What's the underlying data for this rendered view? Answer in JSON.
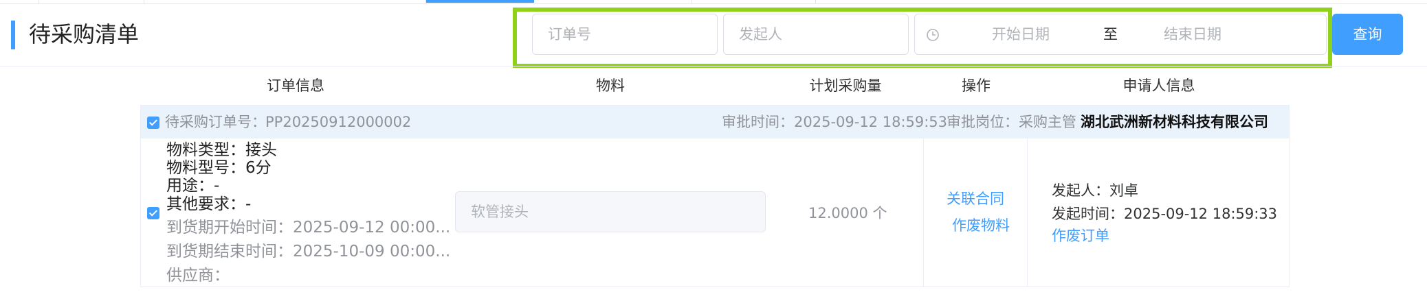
{
  "header": {
    "title": "待采购清单",
    "search": {
      "order_no_placeholder": "订单号",
      "initiator_placeholder": "发起人",
      "start_date_placeholder": "开始日期",
      "date_separator": "至",
      "end_date_placeholder": "结束日期",
      "button_label": "查询"
    }
  },
  "table": {
    "columns": [
      "订单信息",
      "物料",
      "计划采购量",
      "操作",
      "申请人信息"
    ]
  },
  "order": {
    "order_no_label": "待采购订单号：",
    "order_no": "PP20250912000002",
    "approval_time": "审批时间：2025-09-12 18:59:53",
    "approval_post": "审批岗位：采购主管",
    "company": "湖北武洲新材料科技有限公司",
    "details": {
      "material_type": "物料类型：接头",
      "material_model": "物料型号：6分",
      "usage": "用途：-",
      "other_requirements": "其他要求：-",
      "delivery_start": "到货期开始时间：2025-09-12 00:00...",
      "delivery_end": "到货期结束时间：2025-10-09 00:00...",
      "supplier": "供应商："
    },
    "material": "软管接头",
    "planned_quantity": "12.0000 个",
    "actions": {
      "link_contract": "关联合同",
      "void_material": "作废物料"
    },
    "applicant": {
      "initiator": "发起人：刘卓",
      "initiated_at": "发起时间：2025-09-12 18:59:33",
      "void_order": "作废订单"
    }
  },
  "colors": {
    "accent": "#409eff",
    "highlight": "#8fd219",
    "group_header_bg": "#eaf3fb"
  }
}
